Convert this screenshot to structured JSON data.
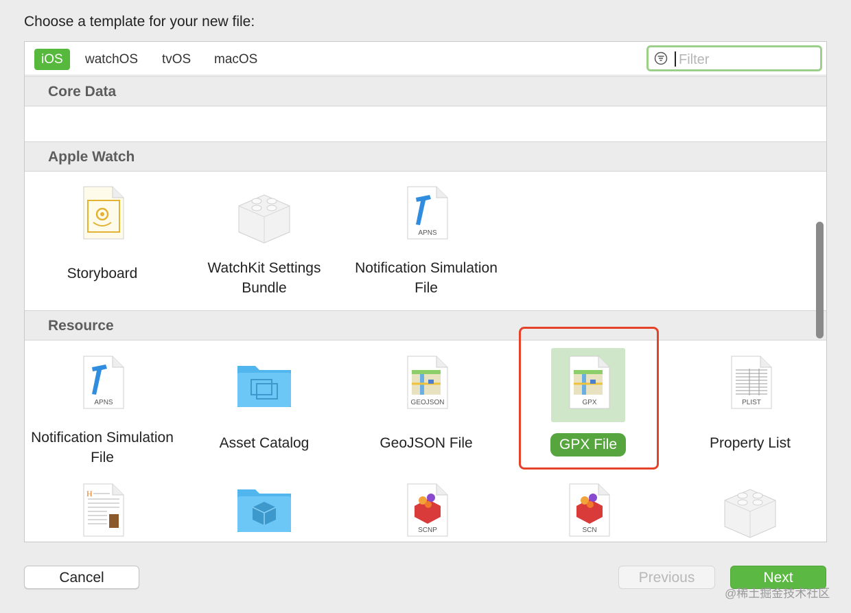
{
  "heading": "Choose a template for your new file:",
  "tabs": [
    {
      "label": "iOS",
      "active": true
    },
    {
      "label": "watchOS",
      "active": false
    },
    {
      "label": "tvOS",
      "active": false
    },
    {
      "label": "macOS",
      "active": false
    }
  ],
  "filter": {
    "placeholder": "Filter",
    "value": ""
  },
  "sections": {
    "core_data": {
      "title": "Core Data"
    },
    "apple_watch": {
      "title": "Apple Watch",
      "items": [
        {
          "label": "Storyboard",
          "icon": "storyboard-file-icon"
        },
        {
          "label": "WatchKit Settings Bundle",
          "icon": "lego-brick-icon"
        },
        {
          "label": "Notification Simulation File",
          "icon": "apns-file-icon",
          "badge": "APNS"
        }
      ]
    },
    "resource": {
      "title": "Resource",
      "items": [
        {
          "label": "Notification Simulation File",
          "icon": "apns-file-icon",
          "badge": "APNS"
        },
        {
          "label": "Asset Catalog",
          "icon": "folder-icon"
        },
        {
          "label": "GeoJSON File",
          "icon": "map-file-icon",
          "badge": "GEOJSON"
        },
        {
          "label": "GPX File",
          "icon": "map-file-icon",
          "badge": "GPX",
          "selected": true
        },
        {
          "label": "Property List",
          "icon": "plist-file-icon",
          "badge": "PLIST"
        }
      ],
      "partial_row": [
        {
          "icon": "rtf-document-icon"
        },
        {
          "icon": "cube-folder-icon"
        },
        {
          "icon": "scenekit-file-icon",
          "badge": "SCNP"
        },
        {
          "icon": "scenekit-file-icon",
          "badge": "SCN"
        },
        {
          "icon": "lego-brick-icon"
        }
      ]
    }
  },
  "buttons": {
    "cancel": "Cancel",
    "previous": "Previous",
    "next": "Next"
  },
  "watermark": "@稀土掘金技术社区",
  "colors": {
    "accent": "#57b83e",
    "selection_bg": "#cfe6c8",
    "highlight": "#e4432a"
  }
}
